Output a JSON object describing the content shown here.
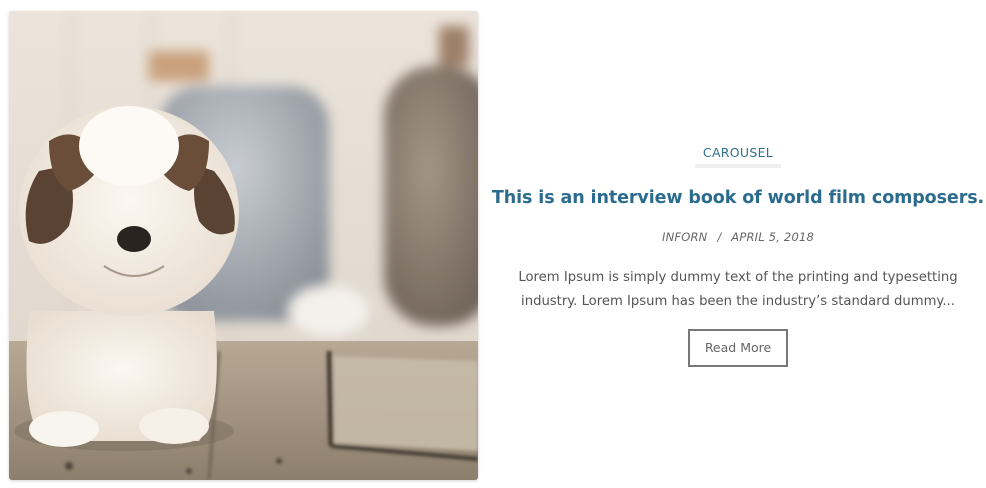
{
  "post": {
    "image_alt_icon": "puppy-photo",
    "category": "CAROUSEL",
    "title": "This is an interview book of world film composers.",
    "author": "INFORN",
    "separator": "/",
    "date": "APRIL 5, 2018",
    "excerpt_lines": [
      "Lorem Ipsum is simply dummy text of the printing and typesetting",
      "industry. Lorem Ipsum has been the industry’s standard dummy..."
    ],
    "read_more_label": "Read More"
  },
  "colors": {
    "accent": "#2b6c8e",
    "category": "#2f6f8f",
    "text": "#555555",
    "meta": "#666666",
    "button_border": "#777777"
  }
}
